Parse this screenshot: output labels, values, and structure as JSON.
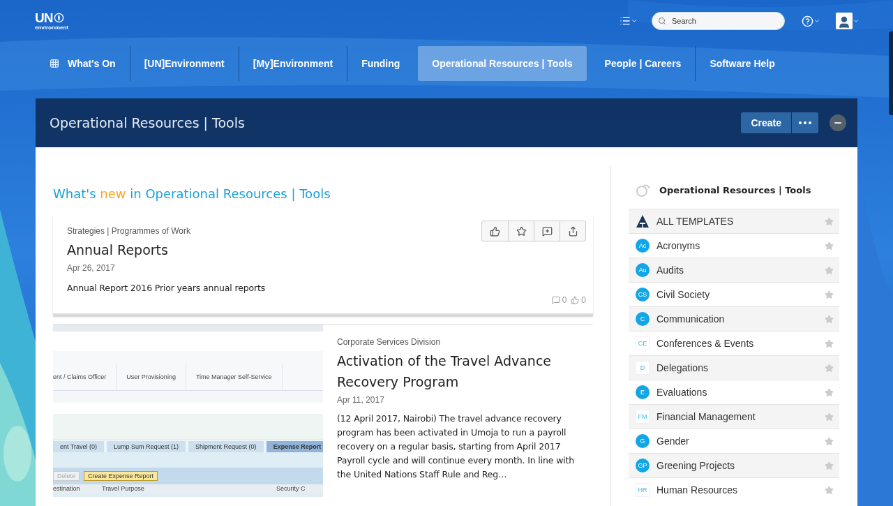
{
  "header": {
    "logo": {
      "main": "UN",
      "sub": "environment"
    },
    "search": {
      "placeholder": "Search"
    }
  },
  "nav": [
    {
      "label": "What's On",
      "kind": "apps",
      "selected": false
    },
    {
      "label": "[UN]Environment",
      "kind": "plain",
      "selected": false
    },
    {
      "label": "[My]Environment",
      "kind": "plain",
      "selected": false
    },
    {
      "label": "Funding",
      "kind": "plain",
      "selected": false
    },
    {
      "label": "Operational Resources | Tools",
      "kind": "plain",
      "selected": true
    },
    {
      "label": "People | Careers",
      "kind": "plain",
      "selected": false
    },
    {
      "label": "Software Help",
      "kind": "plain",
      "selected": false
    }
  ],
  "place": {
    "title": "Operational Resources | Tools",
    "create": "Create"
  },
  "feed": {
    "heading": [
      {
        "text": "What's ",
        "highlight": false
      },
      {
        "text": "new",
        "highlight": true
      },
      {
        "text": " in Operational Resources | Tools",
        "highlight": false
      }
    ],
    "articles": [
      {
        "kind": "text",
        "category": "Strategies | Programmes of Work",
        "title": "Annual Reports",
        "date": "Apr 26, 2017",
        "body": "Annual Report 2016 Prior years annual reports",
        "comments": "0",
        "likes": "0"
      },
      {
        "kind": "screenshot",
        "category": "Corporate Services Division",
        "title": "Activation of the Travel Advance Recovery Program",
        "date": "Apr 11, 2017",
        "body": "(12 April 2017, Nairobi) The travel advance recovery program has been activated in Umoja to run a payroll recovery on a regular basis, starting from April 2017 Payroll cycle and will continue every month. In line with the United Nations Staff Rule and Reg…",
        "screenshot": {
          "menu": [
            "ent / Claims Officer",
            "User Provisioning",
            "Time Manager Self-Service"
          ],
          "tabs": [
            {
              "label": "ent Travel (0)",
              "selected": false
            },
            {
              "label": "Lump Sum Request (1)",
              "selected": false
            },
            {
              "label": "Shipment Request (0)",
              "selected": false
            },
            {
              "label": "Expense Report",
              "selected": true
            }
          ],
          "buttons": [
            {
              "label": "Delete",
              "kind": "disabled"
            },
            {
              "label": "Create Expense Report",
              "kind": "primary"
            }
          ],
          "columns": [
            "estination",
            "Travel Purpose",
            "Security C"
          ]
        }
      }
    ]
  },
  "sidebar": {
    "title": "Operational Resources | Tools",
    "items": [
      {
        "kind": "logo",
        "label": "ALL TEMPLATES"
      },
      {
        "badge": "Ac",
        "kind": "circle",
        "label": "Acronyms"
      },
      {
        "badge": "Au",
        "kind": "circle",
        "label": "Audits"
      },
      {
        "badge": "CS",
        "kind": "circle",
        "label": "Civil Society"
      },
      {
        "badge": "C",
        "kind": "circle",
        "label": "Communication"
      },
      {
        "badge": "CE",
        "kind": "square",
        "label": "Conferences & Events"
      },
      {
        "badge": "D",
        "kind": "square",
        "label": "Delegations"
      },
      {
        "badge": "E",
        "kind": "circle",
        "label": "Evaluations"
      },
      {
        "badge": "FM",
        "kind": "square",
        "label": "Financial Management"
      },
      {
        "badge": "G",
        "kind": "circle",
        "label": "Gender"
      },
      {
        "badge": "GP",
        "kind": "circle",
        "label": "Greening Projects"
      },
      {
        "badge": "HR",
        "kind": "square",
        "label": "Human Resources"
      }
    ]
  }
}
